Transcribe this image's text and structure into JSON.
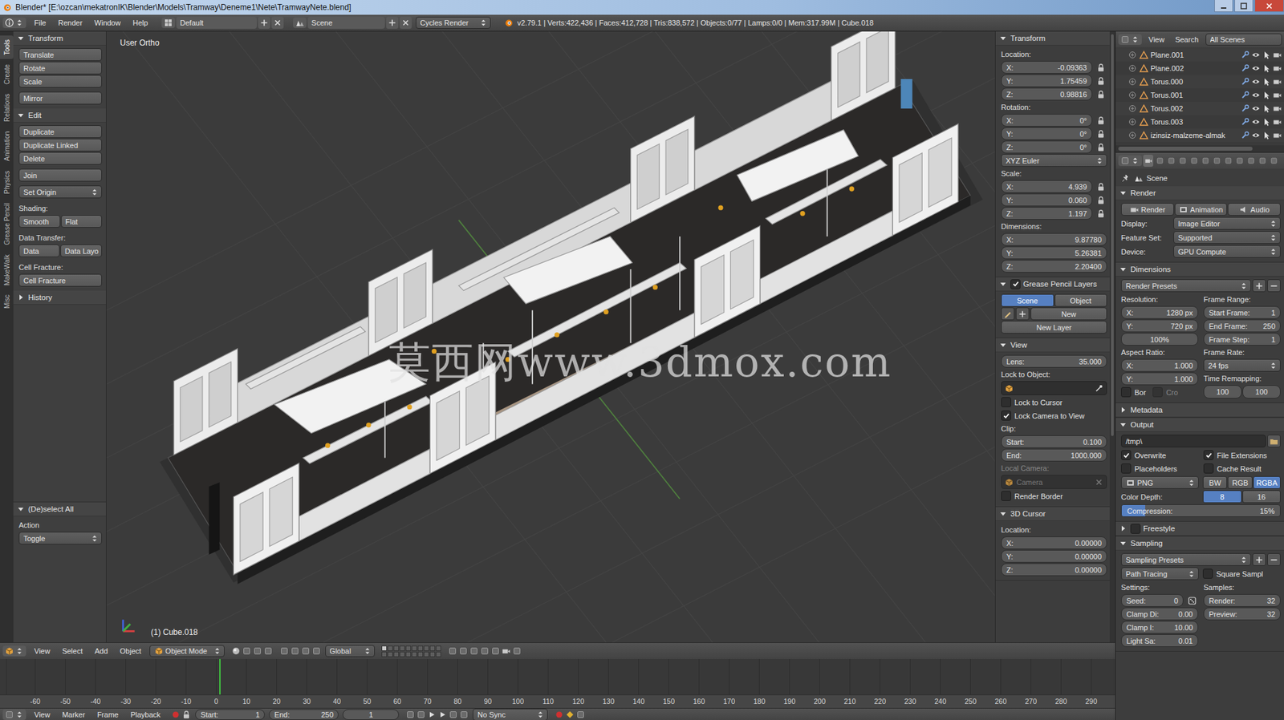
{
  "window": {
    "title": "Blender* [E:\\ozcan\\mekatronIK\\Blender\\Models\\Tramway\\Deneme1\\Nete\\TramwayNete.blend]"
  },
  "top_header": {
    "menus": [
      "File",
      "Render",
      "Window",
      "Help"
    ],
    "layout": "Default",
    "scene": "Scene",
    "engine": "Cycles Render",
    "stats": "v2.79.1 | Verts:422,436 | Faces:412,728 | Tris:838,572 | Objects:0/77 | Lamps:0/0 | Mem:317.99M | Cube.018"
  },
  "tool_tabs": [
    {
      "label": "Tools",
      "selected": true
    },
    {
      "label": "Create",
      "selected": false
    },
    {
      "label": "Relations",
      "selected": false
    },
    {
      "label": "Animation",
      "selected": false
    },
    {
      "label": "Physics",
      "selected": false
    },
    {
      "label": "Grease Pencil",
      "selected": false
    },
    {
      "label": "MakeWalk",
      "selected": false
    },
    {
      "label": "Misc",
      "selected": false
    }
  ],
  "tool_shelf": [
    {
      "title": "Transform",
      "expanded": true,
      "groups": [
        [
          {
            "kind": "buttons",
            "items": [
              "Translate"
            ]
          },
          {
            "kind": "buttons",
            "items": [
              "Rotate"
            ]
          },
          {
            "kind": "buttons",
            "items": [
              "Scale"
            ]
          }
        ],
        [
          {
            "kind": "buttons",
            "items": [
              "Mirror"
            ]
          }
        ]
      ]
    },
    {
      "title": "Edit",
      "expanded": true,
      "groups": [
        [
          {
            "kind": "buttons",
            "items": [
              "Duplicate"
            ]
          },
          {
            "kind": "buttons",
            "items": [
              "Duplicate Linked"
            ]
          },
          {
            "kind": "buttons",
            "items": [
              "Delete"
            ]
          }
        ],
        [
          {
            "kind": "buttons",
            "items": [
              "Join"
            ]
          }
        ],
        [
          {
            "kind": "dropdown",
            "text": "Set Origin"
          }
        ],
        [
          {
            "kind": "label",
            "text": "Shading:"
          },
          {
            "kind": "buttons",
            "items": [
              "Smooth",
              "Flat"
            ]
          }
        ],
        [
          {
            "kind": "label",
            "text": "Data Transfer:"
          },
          {
            "kind": "buttons",
            "items": [
              "Data",
              "Data Layo"
            ]
          }
        ],
        [
          {
            "kind": "label",
            "text": "Cell Fracture:"
          },
          {
            "kind": "buttons",
            "items": [
              "Cell Fracture"
            ]
          }
        ]
      ]
    },
    {
      "title": "History",
      "expanded": false,
      "groups": []
    }
  ],
  "operator": {
    "title": "(De)select All",
    "expanded": true,
    "groups": [
      [
        {
          "kind": "label",
          "text": "Action"
        },
        {
          "kind": "dropdown",
          "text": "Toggle"
        }
      ]
    ]
  },
  "viewport": {
    "view_name": "User Ortho",
    "object_info": "(1) Cube.018",
    "watermark": "莫西网www.3dmox.com"
  },
  "n_panel": [
    {
      "title": "Transform",
      "expanded": true,
      "rows": [
        {
          "kind": "label",
          "text": "Location:"
        },
        {
          "kind": "num",
          "label": "X:",
          "value": "-0.09363",
          "locked": false
        },
        {
          "kind": "num",
          "label": "Y:",
          "value": "1.75459",
          "locked": false
        },
        {
          "kind": "num",
          "label": "Z:",
          "value": "0.98816",
          "locked": false
        },
        {
          "kind": "label",
          "text": "Rotation:"
        },
        {
          "kind": "num",
          "label": "X:",
          "value": "0°",
          "locked": false
        },
        {
          "kind": "num",
          "label": "Y:",
          "value": "0°",
          "locked": false
        },
        {
          "kind": "num",
          "label": "Z:",
          "value": "0°",
          "locked": false
        },
        {
          "kind": "dropdown",
          "text": "XYZ Euler"
        },
        {
          "kind": "label",
          "text": "Scale:"
        },
        {
          "kind": "num",
          "label": "X:",
          "value": "4.939",
          "locked": false
        },
        {
          "kind": "num",
          "label": "Y:",
          "value": "0.060",
          "locked": false
        },
        {
          "kind": "num",
          "label": "Z:",
          "value": "1.197",
          "locked": false
        },
        {
          "kind": "label",
          "text": "Dimensions:"
        },
        {
          "kind": "num",
          "label": "X:",
          "value": "9.87780"
        },
        {
          "kind": "num",
          "label": "Y:",
          "value": "5.26381"
        },
        {
          "kind": "num",
          "label": "Z:",
          "value": "2.20400"
        }
      ]
    },
    {
      "title": "Grease Pencil Layers",
      "expanded": true,
      "enabled": true,
      "rows": [
        {
          "kind": "segmented",
          "items": [
            {
              "label": "Scene",
              "selected": true
            },
            {
              "label": "Object",
              "selected": false
            }
          ]
        },
        {
          "kind": "gpnew",
          "text": "New"
        },
        {
          "kind": "button",
          "text": "New Layer"
        }
      ]
    },
    {
      "title": "View",
      "expanded": true,
      "rows": [
        {
          "kind": "num",
          "label": "Lens:",
          "value": "35.000"
        },
        {
          "kind": "label",
          "text": "Lock to Object:"
        },
        {
          "kind": "picker",
          "value": "",
          "disabled": false
        },
        {
          "kind": "check",
          "label": "Lock to Cursor",
          "checked": false
        },
        {
          "kind": "check",
          "label": "Lock Camera to View",
          "checked": true
        },
        {
          "kind": "label",
          "text": "Clip:"
        },
        {
          "kind": "num",
          "label": "Start:",
          "value": "0.100"
        },
        {
          "kind": "num",
          "label": "End:",
          "value": "1000.000"
        },
        {
          "kind": "label",
          "text": "Local Camera:",
          "disabled": true
        },
        {
          "kind": "picker",
          "value": "Camera",
          "disabled": true
        },
        {
          "kind": "check",
          "label": "Render Border",
          "checked": false
        }
      ]
    },
    {
      "title": "3D Cursor",
      "expanded": true,
      "rows": [
        {
          "kind": "label",
          "text": "Location:"
        },
        {
          "kind": "num",
          "label": "X:",
          "value": "0.00000"
        },
        {
          "kind": "num",
          "label": "Y:",
          "value": "0.00000"
        },
        {
          "kind": "num",
          "label": "Z:",
          "value": "0.00000"
        }
      ]
    }
  ],
  "outliner": {
    "menus": [
      "View",
      "Search"
    ],
    "filter": "All Scenes",
    "items": [
      "Plane.001",
      "Plane.002",
      "Torus.000",
      "Torus.001",
      "Torus.002",
      "Torus.003",
      "izinsiz-malzeme-almak"
    ]
  },
  "properties": {
    "tabs": [
      {
        "selected": true
      },
      {
        "selected": false
      },
      {
        "selected": false
      },
      {
        "selected": false
      },
      {
        "selected": false
      },
      {
        "selected": false
      },
      {
        "selected": false
      },
      {
        "selected": false
      },
      {
        "selected": false
      },
      {
        "selected": false
      },
      {
        "selected": false
      },
      {
        "selected": false
      }
    ],
    "breadcrumb": "Scene",
    "sections": [
      {
        "title": "Render",
        "expanded": true,
        "rows": [
          {
            "kind": "iconbuttons",
            "items": [
              "Render",
              "Animation",
              "Audio"
            ]
          },
          {
            "kind": "prop",
            "label": "Display:",
            "value": "Image Editor"
          },
          {
            "kind": "prop",
            "label": "Feature Set:",
            "value": "Supported"
          },
          {
            "kind": "prop",
            "label": "Device:",
            "value": "GPU Compute"
          }
        ]
      },
      {
        "title": "Dimensions",
        "expanded": true,
        "rows": [
          {
            "kind": "preset",
            "text": "Render Presets"
          },
          {
            "kind": "cols",
            "cols": [
              [
                {
                  "kind": "label",
                  "text": "Resolution:"
                },
                {
                  "kind": "num",
                  "label": "X:",
                  "value": "1280 px"
                },
                {
                  "kind": "num",
                  "label": "Y:",
                  "value": "720 px"
                },
                {
                  "kind": "num",
                  "label": "",
                  "value": "100%"
                },
                {
                  "kind": "label",
                  "text": "Aspect Ratio:"
                },
                {
                  "kind": "num",
                  "label": "X:",
                  "value": "1.000"
                },
                {
                  "kind": "num",
                  "label": "Y:",
                  "value": "1.000"
                },
                {
                  "kind": "checks",
                  "items": [
                    {
                      "label": "Bor",
                      "checked": false,
                      "disabled": false
                    },
                    {
                      "label": "Cro",
                      "checked": false,
                      "disabled": true
                    }
                  ]
                }
              ],
              [
                {
                  "kind": "label",
                  "text": "Frame Range:"
                },
                {
                  "kind": "num",
                  "label": "Start Frame:",
                  "value": "1"
                },
                {
                  "kind": "num",
                  "label": "End Frame:",
                  "value": "250"
                },
                {
                  "kind": "num",
                  "label": "Frame Step:",
                  "value": "1"
                },
                {
                  "kind": "label",
                  "text": "Frame Rate:"
                },
                {
                  "kind": "dropdown",
                  "text": "24 fps"
                },
                {
                  "kind": "label",
                  "text": "Time Remapping:"
                },
                {
                  "kind": "nums",
                  "items": [
                    "100",
                    "100"
                  ]
                }
              ]
            ]
          }
        ]
      },
      {
        "title": "Metadata",
        "expanded": false,
        "rows": []
      },
      {
        "title": "Output",
        "expanded": true,
        "rows": [
          {
            "kind": "path",
            "value": "/tmp\\"
          },
          {
            "kind": "cols",
            "cols": [
              [
                {
                  "kind": "check",
                  "label": "Overwrite",
                  "checked": true
                },
                {
                  "kind": "check",
                  "label": "Placeholders",
                  "checked": false
                }
              ],
              [
                {
                  "kind": "check",
                  "label": "File Extensions",
                  "checked": true
                },
                {
                  "kind": "check",
                  "label": "Cache Result",
                  "checked": false
                }
              ]
            ]
          },
          {
            "kind": "format",
            "value": "PNG",
            "items": [
              {
                "label": "BW",
                "selected": false
              },
              {
                "label": "RGB",
                "selected": false
              },
              {
                "label": "RGBA",
                "selected": true
              }
            ]
          },
          {
            "kind": "labeled_seg",
            "label": "Color Depth:",
            "items": [
              {
                "label": "8",
                "selected": true
              },
              {
                "label": "16",
                "selected": false
              }
            ]
          },
          {
            "kind": "slider",
            "label": "Compression:",
            "value": "15%",
            "level": 0.15
          }
        ]
      },
      {
        "title": "Freestyle",
        "expanded": false,
        "enabled": false,
        "rows": []
      },
      {
        "title": "Sampling",
        "expanded": true,
        "rows": [
          {
            "kind": "preset",
            "text": "Sampling Presets"
          },
          {
            "kind": "dd_check",
            "value": "Path Tracing",
            "label": "Square Sampl",
            "checked": false
          },
          {
            "kind": "cols",
            "cols": [
              [
                {
                  "kind": "label",
                  "text": "Settings:"
                },
                {
                  "kind": "seednum",
                  "label": "Seed:",
                  "value": "0"
                },
                {
                  "kind": "num",
                  "label": "Clamp Di:",
                  "value": "0.00"
                },
                {
                  "kind": "num",
                  "label": "Clamp I:",
                  "value": "10.00"
                },
                {
                  "kind": "num",
                  "label": "Light Sa:",
                  "value": "0.01"
                }
              ],
              [
                {
                  "kind": "label",
                  "text": "Samples:"
                },
                {
                  "kind": "num",
                  "label": "Render:",
                  "value": "32"
                },
                {
                  "kind": "num",
                  "label": "Preview:",
                  "value": "32"
                }
              ]
            ]
          }
        ]
      }
    ]
  },
  "viewport_header": {
    "menus": [
      "View",
      "Select",
      "Add",
      "Object"
    ],
    "mode": "Object Mode",
    "orientation": "Global"
  },
  "timeline": {
    "ruler": [
      "-60",
      "-50",
      "-40",
      "-30",
      "-20",
      "-10",
      "0",
      "10",
      "20",
      "30",
      "40",
      "50",
      "60",
      "70",
      "80",
      "90",
      "100",
      "110",
      "120",
      "130",
      "140",
      "150",
      "160",
      "170",
      "180",
      "190",
      "200",
      "210",
      "220",
      "230",
      "240",
      "250",
      "260",
      "270",
      "280",
      "290"
    ]
  },
  "bottom_header": {
    "menus": [
      "View",
      "Marker",
      "Frame",
      "Playback"
    ],
    "start": {
      "label": "Start:",
      "value": "1"
    },
    "end": {
      "label": "End:",
      "value": "250"
    },
    "current": "1",
    "sync": "No Sync"
  }
}
